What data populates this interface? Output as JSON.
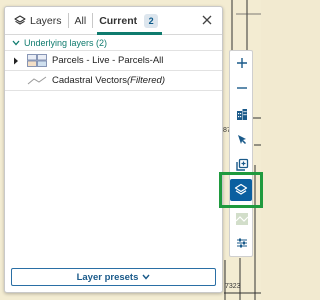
{
  "panel": {
    "tabs": {
      "layers_label": "Layers",
      "all_label": "All",
      "current_label": "Current",
      "current_count": "2"
    },
    "section": {
      "label": "Underlying layers (2)"
    },
    "layers": [
      {
        "name": "Parcels - Live - Parcels-All"
      },
      {
        "name": "Cadastral Vectors ",
        "suffix": "(Filtered)"
      }
    ],
    "presets_label": "Layer presets"
  },
  "map": {
    "labels": {
      "label_a": "87",
      "label_b": "7323"
    }
  },
  "colors": {
    "accent": "#0f7b6e",
    "toolbar_active": "#0a5fa0",
    "highlight": "#1f9a3e",
    "icon": "#1a5a8a"
  },
  "icons": {
    "layers_tab": "layers-icon",
    "close": "close-icon",
    "chevron": "chevron-down-icon",
    "expander": "caret-right-icon",
    "parcels_legend": "parcels-legend-icon",
    "cadastral_legend": "line-legend-icon",
    "zoom_in": "plus-icon",
    "zoom_out": "minus-icon",
    "buildings": "buildings-icon",
    "select": "cursor-icon",
    "add_layer": "add-layer-icon",
    "layers": "layers-icon",
    "basemap": "basemap-icon",
    "settings": "sliders-icon"
  }
}
